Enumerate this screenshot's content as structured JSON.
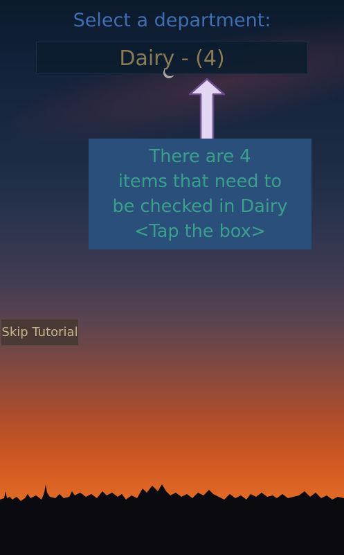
{
  "prompt": {
    "label": "Select a department:"
  },
  "department_selector": {
    "value": "Dairy - (4)"
  },
  "tutorial": {
    "message": "There are 4\nitems that need to\nbe checked in Dairy\n   <Tap the box>"
  },
  "skip_button": {
    "label": "Skip Tutorial"
  },
  "colors": {
    "prompt_text": "#3f6fb2",
    "selector_text": "#8a7a55",
    "tip_background": "#2a4f7a",
    "tip_text": "#3aa08c",
    "arrow_fill": "#e2d6f2",
    "skip_text": "#c8b48a"
  },
  "icons": {
    "pointer": "up-arrow-icon"
  }
}
